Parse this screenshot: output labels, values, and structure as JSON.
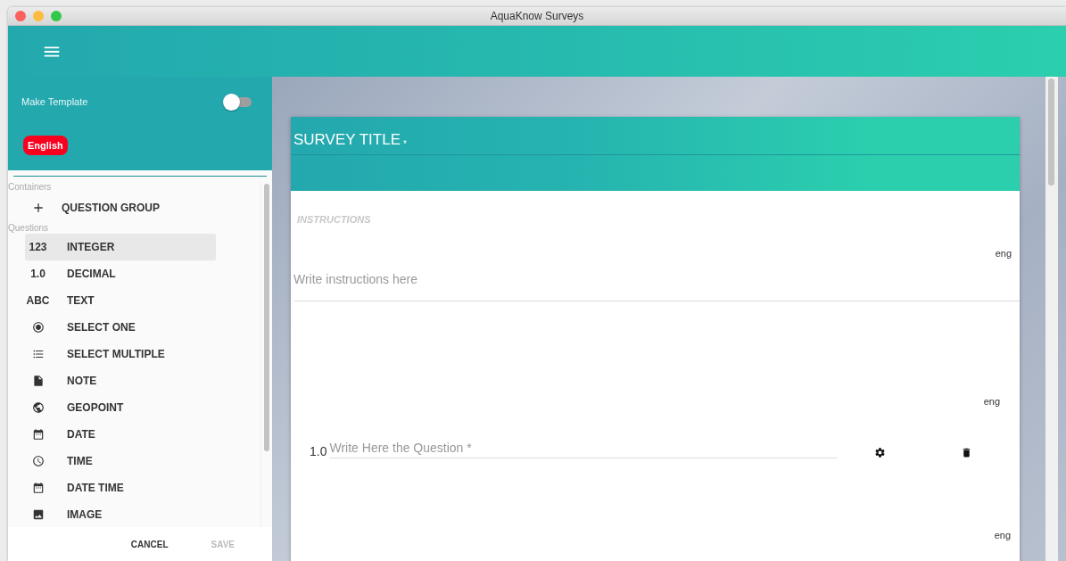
{
  "window": {
    "title": "AquaKnow Surveys"
  },
  "sidebar": {
    "make_template": {
      "label": "Make Template",
      "on": false
    },
    "language": "English",
    "containers": {
      "label": "Containers",
      "items": [
        {
          "kind": "add",
          "label": "QUESTION GROUP"
        }
      ]
    },
    "questions": {
      "label": "Questions",
      "items": [
        {
          "kind": "glyph",
          "glyph": "123",
          "label": "INTEGER",
          "selected": true
        },
        {
          "kind": "glyph",
          "glyph": "1.0",
          "label": "DECIMAL",
          "selected": false
        },
        {
          "kind": "glyph",
          "glyph": "ABC",
          "label": "TEXT",
          "selected": false
        },
        {
          "kind": "radio",
          "label": "SELECT ONE",
          "selected": false
        },
        {
          "kind": "list",
          "label": "SELECT MULTIPLE",
          "selected": false
        },
        {
          "kind": "note",
          "label": "NOTE",
          "selected": false
        },
        {
          "kind": "globe",
          "label": "GEOPOINT",
          "selected": false
        },
        {
          "kind": "calendar",
          "label": "DATE",
          "selected": false
        },
        {
          "kind": "clock",
          "label": "TIME",
          "selected": false
        },
        {
          "kind": "calendar",
          "label": "DATE TIME",
          "selected": false
        },
        {
          "kind": "image",
          "label": "IMAGE",
          "selected": false
        }
      ]
    },
    "buttons": [
      {
        "label": "CANCEL",
        "disabled": false
      },
      {
        "label": "SAVE",
        "disabled": true
      }
    ]
  },
  "survey": {
    "title": "SURVEY TITLE",
    "required_mark": "*",
    "instructions": {
      "label": "INSTRUCTIONS",
      "language": "eng",
      "placeholder": "Write instructions here"
    },
    "questions": [
      {
        "language": "eng",
        "number": "1.0",
        "placeholder": "Write Here the Question *"
      }
    ],
    "next_language": "eng"
  }
}
